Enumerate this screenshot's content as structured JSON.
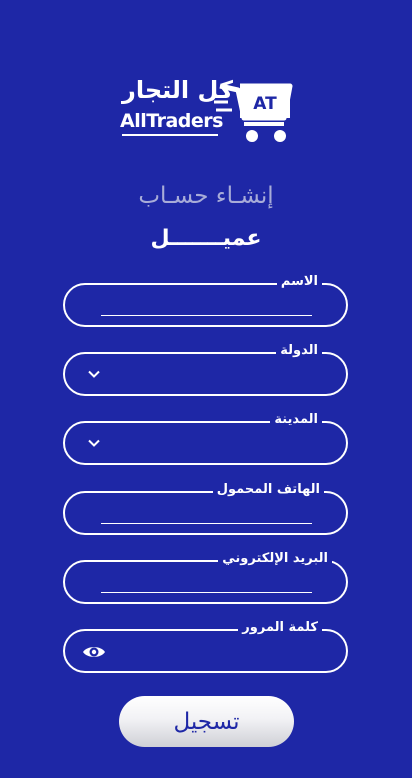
{
  "logo": {
    "arabic": "كل التجار",
    "english": "AllTraders",
    "badge": "AT"
  },
  "headings": {
    "title": "إنشـاء حسـاب",
    "subtitle": "عميـــــــل"
  },
  "fields": [
    {
      "label": "الاسم",
      "type": "text",
      "value": ""
    },
    {
      "label": "الدولة",
      "type": "select",
      "value": ""
    },
    {
      "label": "المدينة",
      "type": "select",
      "value": ""
    },
    {
      "label": "الهاتف المحمول",
      "type": "text",
      "value": ""
    },
    {
      "label": "البريد الإلكتروني",
      "type": "text",
      "value": ""
    },
    {
      "label": "كلمة المرور",
      "type": "password",
      "value": ""
    }
  ],
  "icons": {
    "select": "chevron-down-icon",
    "password_toggle": "eye-icon"
  },
  "submit_label": "تسجيل",
  "colors": {
    "background": "#1e27a6",
    "text": "#ffffff",
    "button_text": "#1e27a6"
  }
}
